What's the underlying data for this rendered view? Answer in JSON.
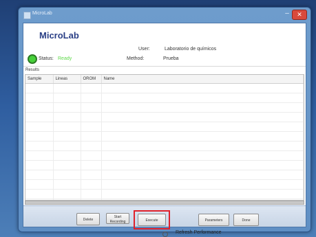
{
  "window": {
    "title": "MicroLab",
    "min_glyph": "–",
    "close_glyph": "✕"
  },
  "app": {
    "title": "MicroLab",
    "user_label": "User:",
    "user_value": "Laboratorio de químicos",
    "method_label": "Method:",
    "method_value": "Prueba",
    "status_label": "Status:",
    "status_value": "Ready",
    "status_color": "#5fd94a"
  },
  "results": {
    "label": "Results",
    "columns": [
      "Sample",
      "Lineas",
      "OROM",
      "Name"
    ],
    "row_count": 14
  },
  "buttons": {
    "delete": "Delete",
    "start_line1": "Start",
    "start_line2": "Recording",
    "execute": "Execute",
    "parameters": "Parameters",
    "done": "Done"
  },
  "footer": {
    "text": "Refresh Performance"
  }
}
